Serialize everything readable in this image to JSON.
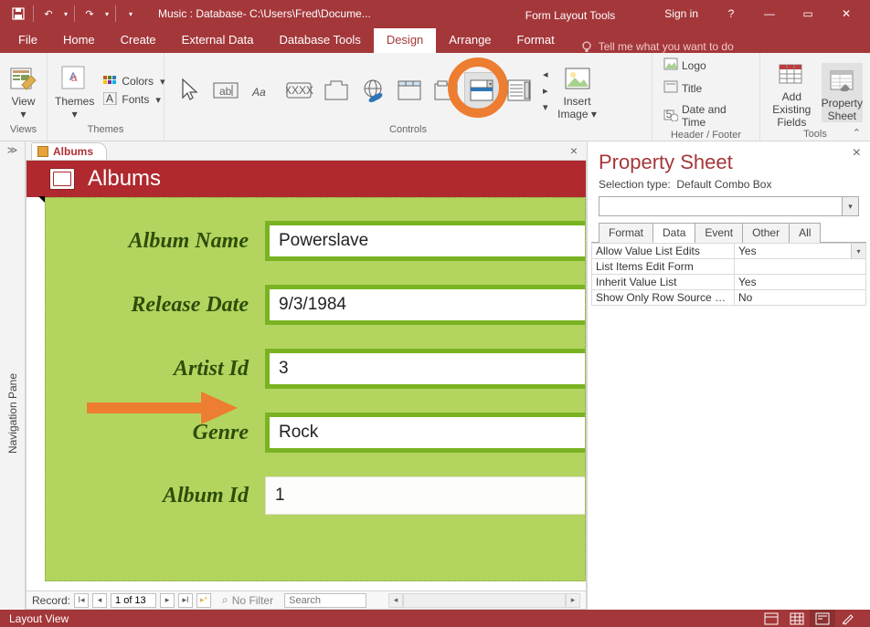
{
  "titlebar": {
    "title": "Music : Database- C:\\Users\\Fred\\Docume...",
    "context_title": "Form Layout Tools",
    "sign_in": "Sign in"
  },
  "menu": {
    "tabs": [
      "File",
      "Home",
      "Create",
      "External Data",
      "Database Tools",
      "Design",
      "Arrange",
      "Format"
    ],
    "active": "Design",
    "tell_me": "Tell me what you want to do"
  },
  "ribbon": {
    "views": {
      "label": "Views",
      "view_btn": "View"
    },
    "themes": {
      "label": "Themes",
      "themes_btn": "Themes",
      "colors": "Colors",
      "fonts": "Fonts"
    },
    "controls": {
      "label": "Controls"
    },
    "image": {
      "btn": "Insert\nImage"
    },
    "header": {
      "label": "Header / Footer",
      "logo": "Logo",
      "title": "Title",
      "date": "Date and Time"
    },
    "tools": {
      "label": "Tools",
      "existing": "Add Existing\nFields",
      "prop": "Property\nSheet"
    }
  },
  "nav_pane": "Navigation Pane",
  "doc_tab": "Albums",
  "form": {
    "title": "Albums",
    "fields": {
      "album_name": {
        "label": "Album Name",
        "value": "Powerslave"
      },
      "release_date": {
        "label": "Release Date",
        "value": "9/3/1984"
      },
      "artist_id": {
        "label": "Artist Id",
        "value": "3"
      },
      "genre": {
        "label": "Genre",
        "value": "Rock"
      },
      "album_id": {
        "label": "Album Id",
        "value": "1"
      }
    }
  },
  "recnav": {
    "label": "Record:",
    "pos": "1 of 13",
    "filter": "No Filter",
    "search": "Search"
  },
  "propsheet": {
    "title": "Property Sheet",
    "selection_label": "Selection type:",
    "selection_value": "Default Combo Box",
    "tabs": [
      "Format",
      "Data",
      "Event",
      "Other",
      "All"
    ],
    "active_tab": "Data",
    "rows": [
      {
        "k": "Allow Value List Edits",
        "v": "Yes",
        "dd": true
      },
      {
        "k": "List Items Edit Form",
        "v": ""
      },
      {
        "k": "Inherit Value List",
        "v": "Yes"
      },
      {
        "k": "Show Only Row Source Values",
        "v": "No"
      }
    ]
  },
  "statusbar": {
    "text": "Layout View"
  }
}
